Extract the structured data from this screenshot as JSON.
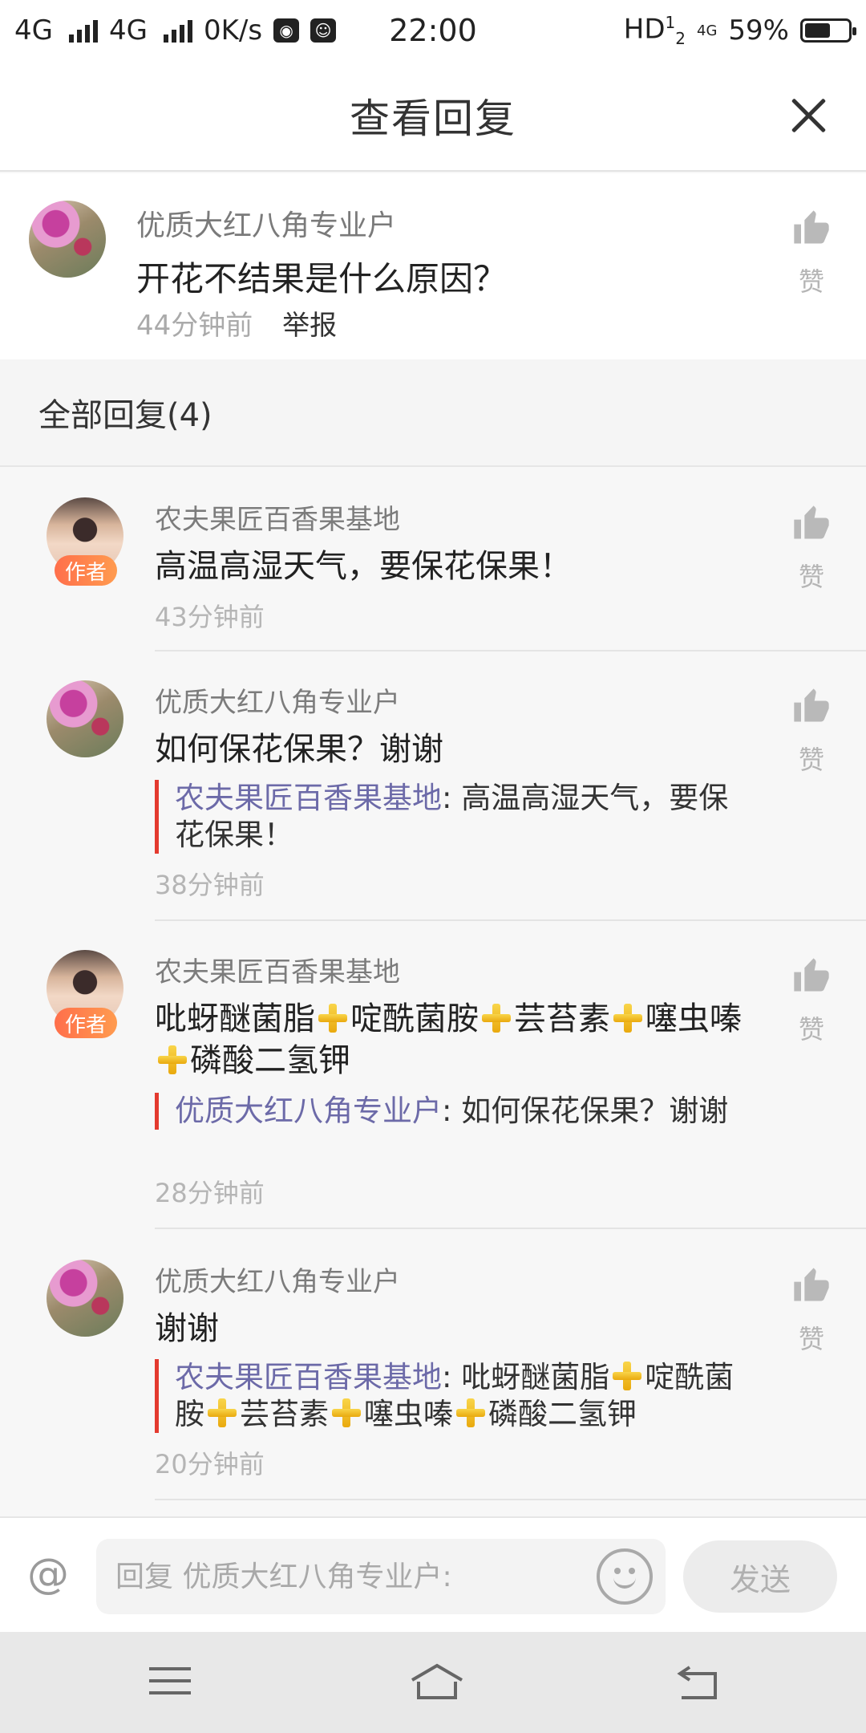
{
  "status_bar": {
    "network1": "4G",
    "network2": "4G",
    "speed": "0K/s",
    "time": "22:00",
    "hd": "HD",
    "hd_sup": "1",
    "hd_sub": "2",
    "net_right": "4G",
    "battery": "59%",
    "battery_level": 0.59
  },
  "header": {
    "title": "查看回复",
    "close_icon": "close-icon"
  },
  "post": {
    "user": "优质大红八角专业户",
    "text": "开花不结果是什么原因？",
    "time": "44分钟前",
    "report": "举报",
    "like_label": "赞"
  },
  "section": {
    "title": "全部回复(4)"
  },
  "replies": [
    {
      "user": "农夫果匠百香果基地",
      "author_badge": "作者",
      "text": "高温高湿天气，要保花保果！",
      "time": "43分钟前",
      "like_label": "赞"
    },
    {
      "user": "优质大红八角专业户",
      "text": "如何保花保果？谢谢",
      "quote_name": "农夫果匠百香果基地",
      "quote_text": ": 高温高湿天气，要保花保果！",
      "time": "38分钟前",
      "like_label": "赞"
    },
    {
      "user": "农夫果匠百香果基地",
      "author_badge": "作者",
      "text_parts": [
        "吡蚜醚菌脂",
        "啶酰菌胺",
        "芸苔素",
        "噻虫嗪",
        "磷酸二氢钾"
      ],
      "quote_name": "优质大红八角专业户",
      "quote_text": ": 如何保花保果？谢谢",
      "time": "28分钟前",
      "like_label": "赞"
    },
    {
      "user": "优质大红八角专业户",
      "text": "谢谢",
      "quote_name": "农夫果匠百香果基地",
      "quote_parts": [
        ": 吡蚜醚菌脂",
        "啶酰菌胺",
        "芸苔素",
        "噻虫嗪",
        "磷酸二氢钾"
      ],
      "time": "20分钟前",
      "like_label": "赞"
    }
  ],
  "input_bar": {
    "at_symbol": "@",
    "placeholder": "回复 优质大红八角专业户:",
    "send_label": "发送"
  }
}
